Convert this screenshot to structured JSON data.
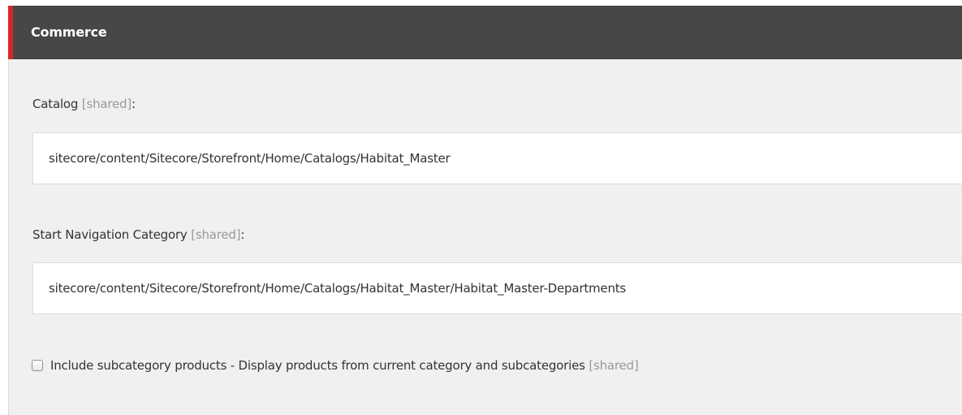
{
  "section": {
    "title": "Commerce",
    "accent_color": "#d8262a",
    "header_color": "#474747"
  },
  "fields": {
    "catalog": {
      "label": "Catalog",
      "shared_tag": "[shared]",
      "colon": ":",
      "value": "sitecore/content/Sitecore/Storefront/Home/Catalogs/Habitat_Master"
    },
    "start_nav": {
      "label": "Start Navigation Category",
      "shared_tag": "[shared]",
      "colon": ":",
      "value": "sitecore/content/Sitecore/Storefront/Home/Catalogs/Habitat_Master/Habitat_Master-Departments"
    },
    "include_subcategory": {
      "label": "Include subcategory products - Display products from current category and subcategories",
      "shared_tag": "[shared]",
      "checked": false
    }
  }
}
